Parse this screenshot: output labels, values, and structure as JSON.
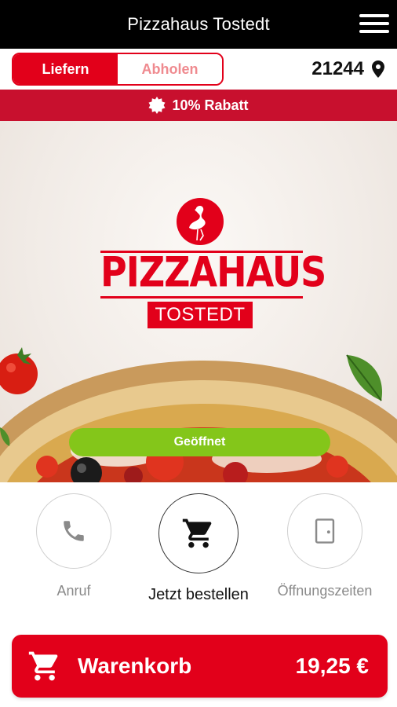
{
  "app": {
    "title": "Pizzahaus Tostedt"
  },
  "mode": {
    "deliver_label": "Liefern",
    "pickup_label": "Abholen",
    "active": "Liefern"
  },
  "location": {
    "zip": "21244"
  },
  "promo": {
    "text": "10% Rabatt"
  },
  "hero": {
    "logo_main": "PIZZAHAUS",
    "logo_sub": "TOSTEDT",
    "status": "Geöffnet"
  },
  "actions": {
    "call_label": "Anruf",
    "order_label": "Jetzt bestellen",
    "hours_label": "Öffnungszeiten"
  },
  "cart": {
    "label": "Warenkorb",
    "total": "19,25 €"
  },
  "colors": {
    "brand_red": "#e2001a",
    "promo_red": "#c8102e",
    "open_green": "#84c61a",
    "topbar": "#000000"
  },
  "icons": [
    "menu-icon",
    "location-pin-icon",
    "badge-icon",
    "flamingo-icon",
    "phone-icon",
    "cart-icon",
    "door-icon"
  ]
}
